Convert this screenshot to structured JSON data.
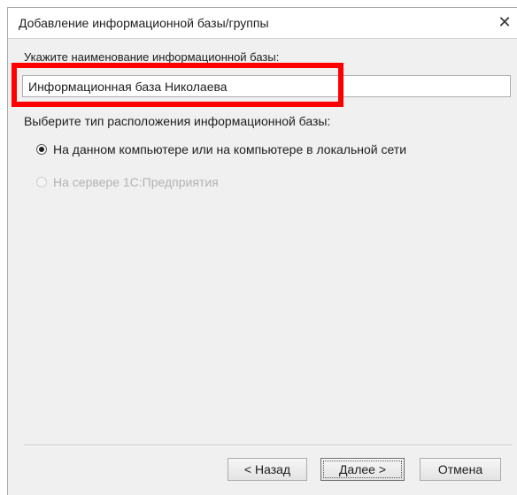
{
  "window": {
    "title": "Добавление информационной базы/группы",
    "close_glyph": "✕"
  },
  "name_field": {
    "label": "Укажите наименование информационной базы:",
    "value": "Информационная база Николаева"
  },
  "location": {
    "label": "Выберите тип расположения информационной базы:",
    "options": [
      {
        "label": "На данном компьютере или на компьютере в локальной сети",
        "selected": true,
        "enabled": true
      },
      {
        "label": "На сервере 1С:Предприятия",
        "selected": false,
        "enabled": false
      }
    ]
  },
  "buttons": {
    "back_label": "< Назад",
    "next_label": "Далее >",
    "cancel_label": "Отмена"
  },
  "colors": {
    "highlight": "#ff0000",
    "window_bg": "#f0f0f0"
  }
}
